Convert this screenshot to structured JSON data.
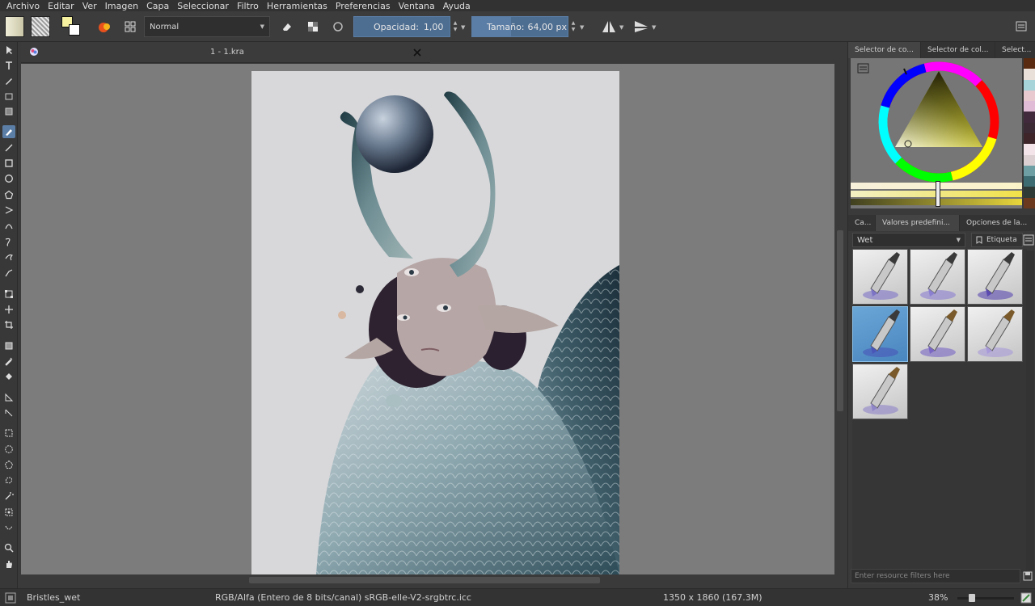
{
  "menu": [
    "Archivo",
    "Editar",
    "Ver",
    "Imagen",
    "Capa",
    "Seleccionar",
    "Filtro",
    "Herramientas",
    "Preferencias",
    "Ventana",
    "Ayuda"
  ],
  "toolbar": {
    "blend_mode": "Normal",
    "opacity_label": "Opacidad:",
    "opacity_value": "1,00",
    "size_label": "Tamaño:",
    "size_value": "64,00 px"
  },
  "document": {
    "tab_title": "1 - 1.kra"
  },
  "dock": {
    "top_tabs": [
      "Selector de co...",
      "Selector de col...",
      "Select..."
    ],
    "bottom_tabs": [
      "Ca...",
      "Valores predefini...",
      "Opciones de la..."
    ],
    "preset_filter": "Wet",
    "tag_label": "Etiqueta",
    "resource_filter_placeholder": "Enter resource filters here"
  },
  "palette_colors": [
    "#5a2a10",
    "#e9e1d9",
    "#a7d4d8",
    "#e7c9cf",
    "#e1bcd7",
    "#402a3c",
    "#3b2933",
    "#3d2529",
    "#f2e4e9",
    "#dcd0d2",
    "#6e9fa5",
    "#3e6c73",
    "#2d3a35",
    "#6b3a1e"
  ],
  "presets": [
    {
      "name": "preset-wet-1",
      "selected": false
    },
    {
      "name": "preset-wet-2",
      "selected": false
    },
    {
      "name": "preset-wet-3",
      "selected": false
    },
    {
      "name": "preset-wet-4",
      "selected": true
    },
    {
      "name": "preset-wet-5",
      "selected": false
    },
    {
      "name": "preset-wet-6",
      "selected": false
    },
    {
      "name": "preset-wet-7",
      "selected": false
    }
  ],
  "status": {
    "brush": "Bristles_wet",
    "color_model": "RGB/Alfa (Entero de 8 bits/canal)  sRGB-elle-V2-srgbtrc.icc",
    "dimensions": "1350 x 1860 (167.3M)",
    "zoom": "38%"
  }
}
